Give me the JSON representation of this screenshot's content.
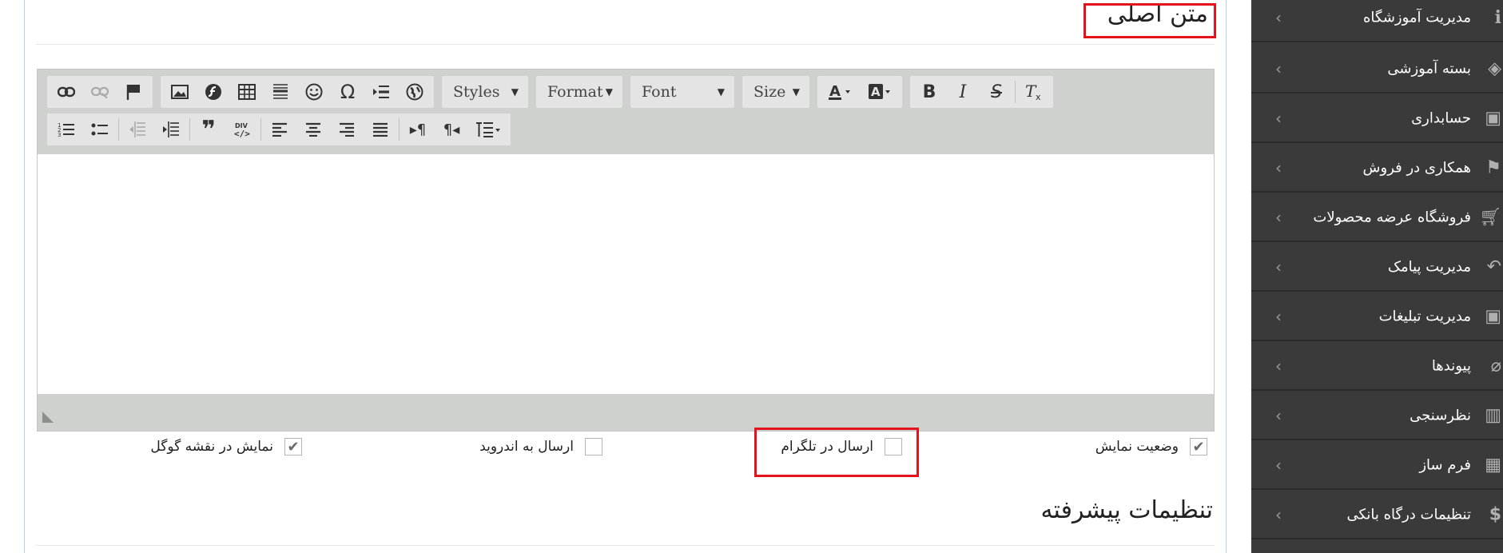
{
  "content": {
    "main_title": "متن اصلی",
    "advanced_title": "تنظیمات پیشرفته"
  },
  "editor": {
    "styles_label": "Styles",
    "format_label": "Format",
    "font_label": "Font",
    "size_label": "Size"
  },
  "options": {
    "display_status": {
      "label": "وضعیت نمایش",
      "checked": true
    },
    "send_telegram": {
      "label": "ارسال در تلگرام",
      "checked": false
    },
    "send_android": {
      "label": "ارسال به اندروید",
      "checked": false
    },
    "show_google_map": {
      "label": "نمایش در نقشه گوگل",
      "checked": true
    }
  },
  "sidebar": {
    "items": [
      {
        "label": "مدیریت آموزشگاه",
        "icon": "info-icon"
      },
      {
        "label": "بسته آموزشی",
        "icon": "layers-icon"
      },
      {
        "label": "حسابداری",
        "icon": "money-icon"
      },
      {
        "label": "همکاری در فروش",
        "icon": "flag-icon"
      },
      {
        "label": "فروشگاه عرضه محصولات",
        "icon": "cart-icon"
      },
      {
        "label": "مدیریت پیامک",
        "icon": "reply-icon"
      },
      {
        "label": "مدیریت تبلیغات",
        "icon": "money-icon"
      },
      {
        "label": "پیوندها",
        "icon": "paperclip-icon"
      },
      {
        "label": "نظرسنجی",
        "icon": "bar-chart-icon"
      },
      {
        "label": "فرم ساز",
        "icon": "table-icon"
      },
      {
        "label": "تنظیمات درگاه بانکی",
        "icon": "dollar-icon"
      }
    ]
  },
  "colors": {
    "sidebar_bg": "#3a3a3a",
    "highlight_red": "#e4121b",
    "toolbar_bg": "#cfd1cf"
  }
}
